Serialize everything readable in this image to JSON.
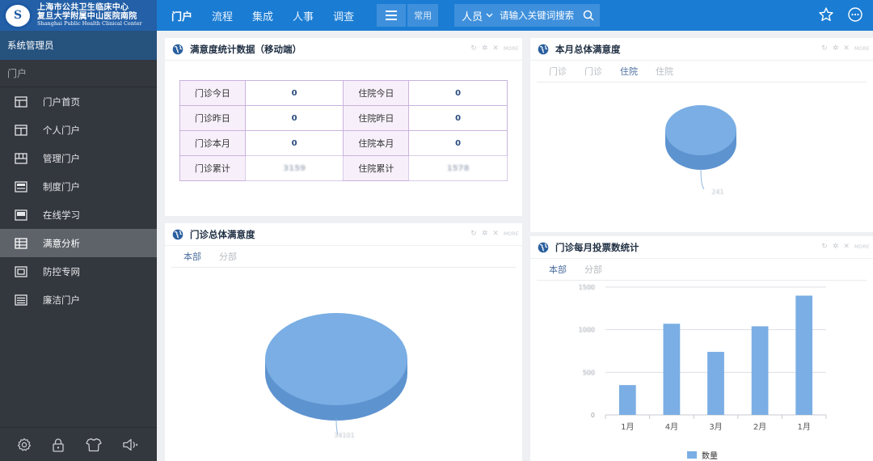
{
  "header": {
    "logo": {
      "line1": "上海市公共卫生临床中心",
      "line2": "复旦大学附属中山医院南院",
      "line3": "Shanghai Public Health Clinical Center",
      "mark": "S"
    },
    "nav": [
      "门户",
      "流程",
      "集成",
      "人事",
      "调查"
    ],
    "menu_icon": "hamburger-icon",
    "common_label": "常用",
    "search": {
      "scope": "人员",
      "placeholder": "请输入关键词搜索"
    },
    "right_icons": [
      "star-icon",
      "more-icon"
    ]
  },
  "sidebar": {
    "user": "系统管理员",
    "section": "门户",
    "items": [
      {
        "label": "门户首页",
        "icon": "layout-icon"
      },
      {
        "label": "个人门户",
        "icon": "window-icon"
      },
      {
        "label": "管理门户",
        "icon": "grid-icon"
      },
      {
        "label": "制度门户",
        "icon": "document-icon"
      },
      {
        "label": "在线学习",
        "icon": "book-icon"
      },
      {
        "label": "满意分析",
        "icon": "table-icon",
        "active": true
      },
      {
        "label": "防控专网",
        "icon": "frame-icon"
      },
      {
        "label": "廉洁门户",
        "icon": "list-icon"
      }
    ],
    "footer_icons": [
      "settings-icon",
      "lock-icon",
      "shirt-icon",
      "volume-icon"
    ]
  },
  "panels": {
    "stats": {
      "title": "满意度统计数据（移动端）",
      "tool_text": "MORE",
      "rows": [
        {
          "l1": "门诊今日",
          "v1": "0",
          "l2": "住院今日",
          "v2": "0"
        },
        {
          "l1": "门诊昨日",
          "v1": "0",
          "l2": "住院昨日",
          "v2": "0"
        },
        {
          "l1": "门诊本月",
          "v1": "0",
          "l2": "住院本月",
          "v2": "0"
        },
        {
          "l1": "门诊累计",
          "v1": "3159",
          "l2": "住院累计",
          "v2": "1578"
        }
      ]
    },
    "monthly": {
      "title": "本月总体满意度",
      "tool_text": "MORE",
      "tabs": [
        "门诊",
        "门诊",
        "住院",
        "住院"
      ],
      "active_tab": 2,
      "pie_label": "241"
    },
    "outpatient": {
      "title": "门诊总体满意度",
      "tool_text": "MORE",
      "tabs": [
        "本部",
        "分部"
      ],
      "active_tab": 0,
      "pie_label": "34101"
    },
    "votes": {
      "title": "门诊每月投票数统计",
      "tool_text": "MORE",
      "tabs": [
        "本部",
        "分部"
      ],
      "active_tab": 0
    }
  },
  "chart_data": {
    "type": "bar",
    "categories": [
      "1月",
      "4月",
      "3月",
      "2月",
      "1月"
    ],
    "series": [
      {
        "name": "数量",
        "values": [
          350,
          1070,
          740,
          1040,
          1400
        ]
      }
    ],
    "ylim": [
      0,
      1500
    ],
    "yticks": [
      "0",
      "500",
      "1000",
      "1500"
    ],
    "grid": true,
    "legend": "bottom",
    "color": "#7aaee4"
  }
}
